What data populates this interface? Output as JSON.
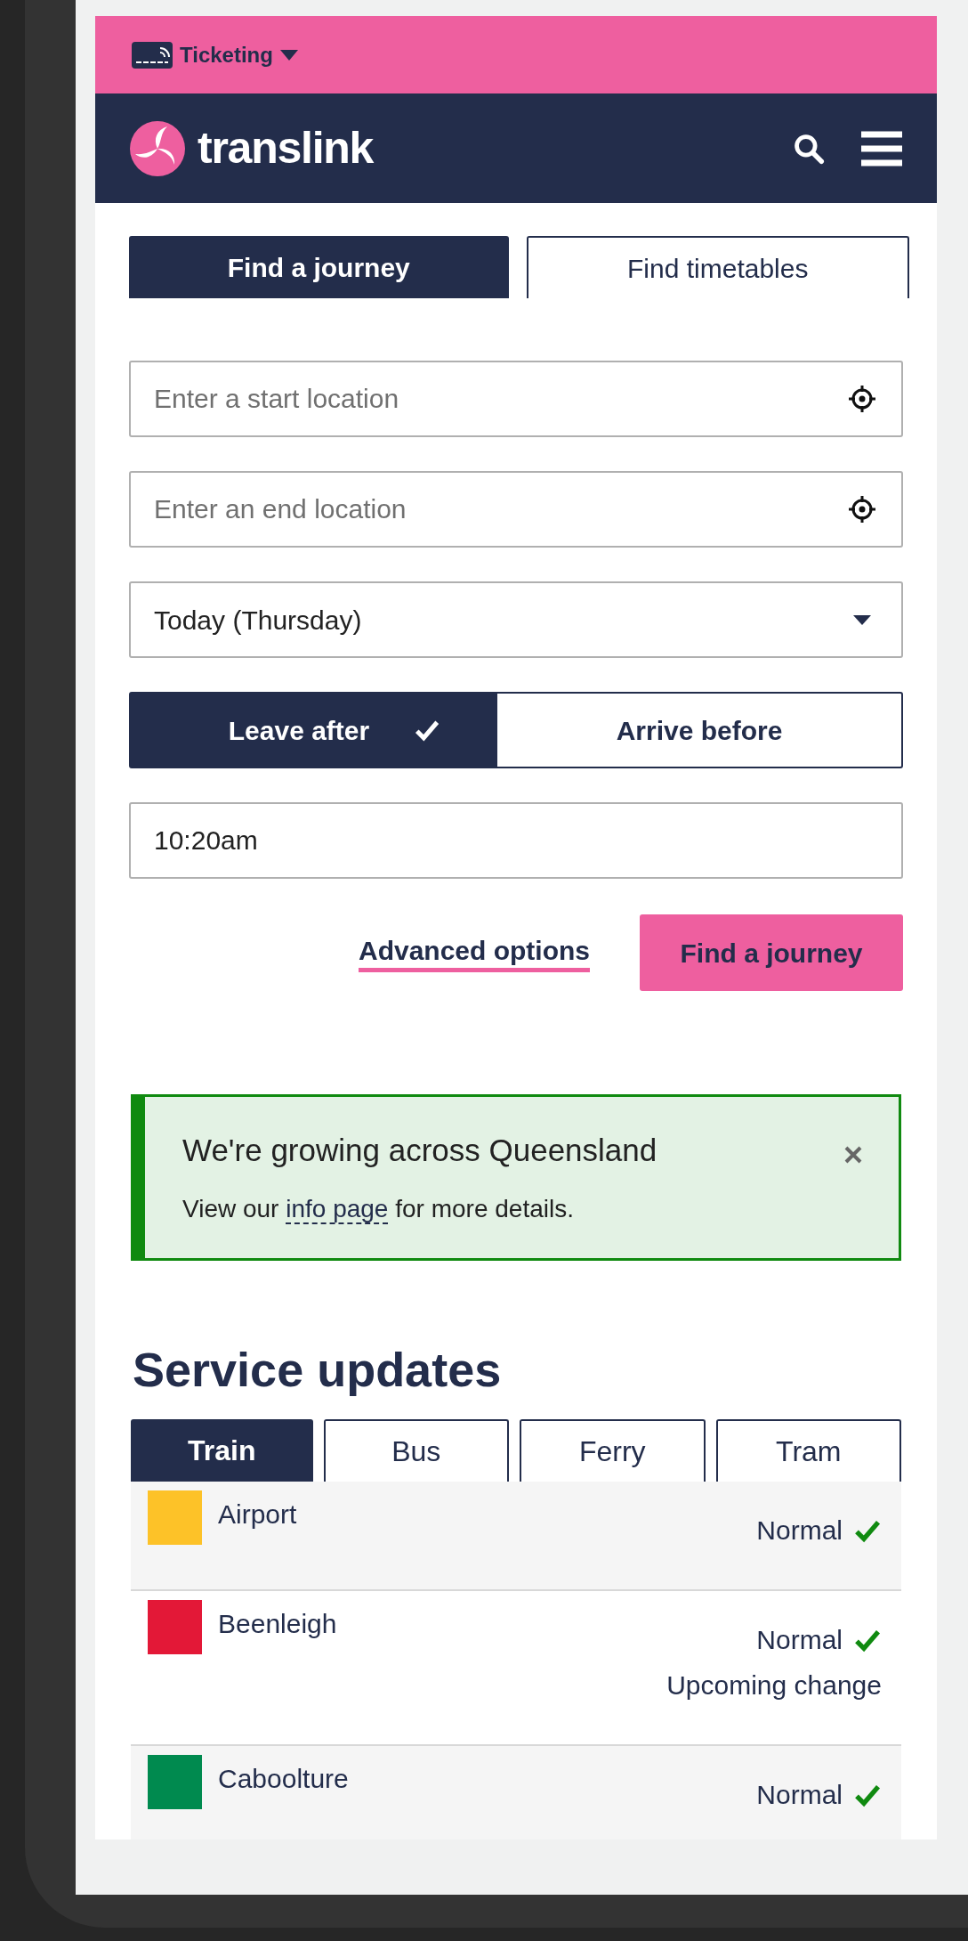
{
  "ticketing": {
    "label": "Ticketing"
  },
  "brand": {
    "name": "translink"
  },
  "journey_tabs": [
    {
      "label": "Find a journey",
      "selected": true
    },
    {
      "label": "Find timetables",
      "selected": false
    }
  ],
  "form": {
    "start": {
      "placeholder": "Enter a start location"
    },
    "end": {
      "placeholder": "Enter an end location"
    },
    "day": {
      "value": "Today (Thursday)"
    },
    "mode_toggle": [
      {
        "label": "Leave after",
        "selected": true
      },
      {
        "label": "Arrive before",
        "selected": false
      }
    ],
    "time": {
      "value": "10:20am"
    },
    "advanced_link": "Advanced options",
    "submit": "Find a journey"
  },
  "notice": {
    "title": "We're growing across Queensland",
    "text_before": "View our ",
    "link": "info page",
    "text_after": " for more details."
  },
  "service_updates": {
    "title": "Service updates",
    "tabs": [
      {
        "label": "Train",
        "selected": true
      },
      {
        "label": "Bus",
        "selected": false
      },
      {
        "label": "Ferry",
        "selected": false
      },
      {
        "label": "Tram",
        "selected": false
      }
    ],
    "lines": [
      {
        "name": "Airport",
        "color": "#fdc228",
        "status": "Normal"
      },
      {
        "name": "Beenleigh",
        "color": "#e31837",
        "status": "Normal",
        "note": "Upcoming change"
      },
      {
        "name": "Caboolture",
        "color": "#008a4f",
        "status": "Normal"
      }
    ]
  }
}
